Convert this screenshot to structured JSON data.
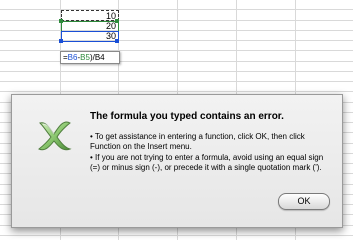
{
  "sheet": {
    "cells": [
      "10",
      "20",
      "30"
    ],
    "formula_tip": {
      "part1": "=",
      "ref1": "B6",
      "op": "-",
      "ref2": "B5",
      "part2": ")/B4"
    }
  },
  "dialog": {
    "title": "The formula you typed contains an error.",
    "bullet1": "• To get assistance in entering a function, click OK, then click Function on the Insert menu.",
    "bullet2": "• If you are not trying to enter a formula, avoid using an equal sign (=) or minus sign (-), or precede it with a single quotation mark (').",
    "ok_label": "OK",
    "icon": "excel-x-icon"
  },
  "colors": {
    "ref_green": "#2e8b3c",
    "ref_blue": "#1a4fd6"
  }
}
